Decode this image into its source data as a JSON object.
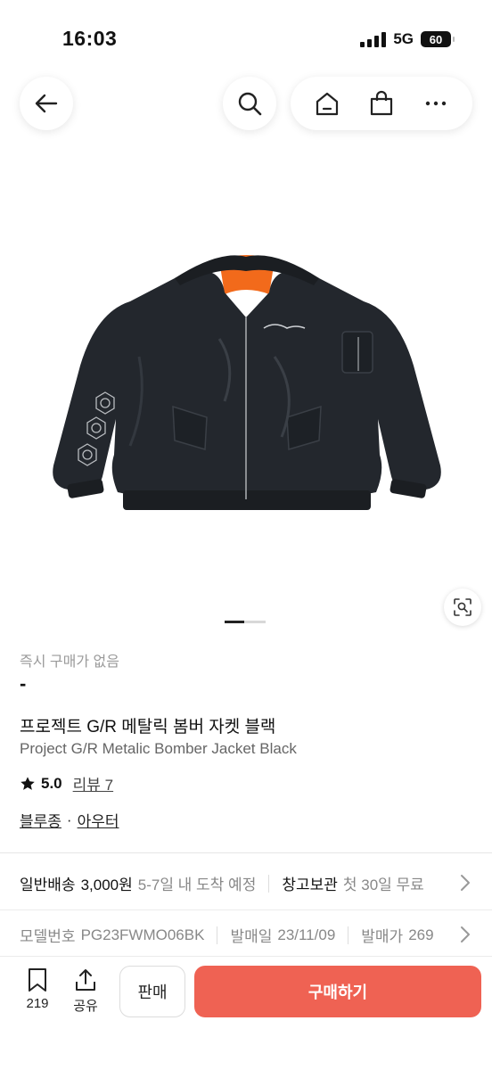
{
  "status_bar": {
    "time": "16:03",
    "network": "5G",
    "battery": "60"
  },
  "nav": {
    "icons": [
      "back-arrow-icon",
      "search-icon",
      "home-icon",
      "shopping-bag-icon",
      "more-icon"
    ]
  },
  "product": {
    "image_desc": "black bomber jacket with orange lining",
    "instant_purchase": "즉시 구매가 없음",
    "price": "-",
    "title_ko": "프로젝트 G/R 메탈릭 봄버 자켓 블랙",
    "title_en": "Project G/R Metalic Bomber Jacket Black",
    "rating": "5.0",
    "review": "리뷰 7",
    "category_1": "블루종",
    "category_sep": "·",
    "category_2": "아우터"
  },
  "shipping": {
    "general_label": "일반배송",
    "general_price": "3,000원",
    "general_eta": "5-7일 내 도착 예정",
    "warehouse_label": "창고보관",
    "warehouse_info": "첫 30일 무료"
  },
  "specs": {
    "model_label": "모델번호",
    "model_value": "PG23FWMO06BK",
    "release_label": "발매일",
    "release_value": "23/11/09",
    "price_label": "발매가",
    "price_value": "269"
  },
  "bottom_bar": {
    "bookmark_count": "219",
    "share_label": "공유",
    "sell_label": "판매",
    "buy_label": "구매하기"
  },
  "colors": {
    "buy_button": "#ef6253",
    "jacket_body": "#23272d",
    "jacket_lining": "#f26a1b"
  }
}
